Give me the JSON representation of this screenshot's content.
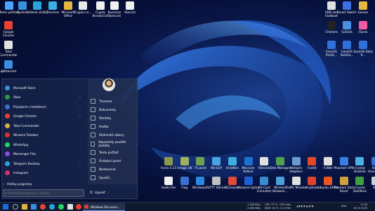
{
  "desktop_left": [
    {
      "label": "Tento počítač",
      "icon": "monitor-icon",
      "color": "#4aa3ff"
    },
    {
      "label": "System",
      "icon": "system-folder-icon",
      "color": "#3b8fe0"
    },
    {
      "label": "Sdílené složky",
      "icon": "shared-folders-icon",
      "color": "#2aa4d8"
    },
    {
      "label": "Thermoz",
      "icon": "thermoz-icon",
      "color": "#3bb0e0"
    },
    {
      "label": "Microsoft Office",
      "icon": "office-folder-icon",
      "color": "#e5b740"
    },
    {
      "label": "Crypto-co...",
      "icon": "crypto-file-icon",
      "color": "#e8e8e8"
    },
    {
      "label": "Crypto Revolut.txt",
      "icon": "text-file-icon",
      "color": "#f0f0f0"
    },
    {
      "label": "Business Tasks.txt",
      "icon": "text-file-icon",
      "color": "#f0f0f0"
    },
    {
      "label": "Stav.txt",
      "icon": "text-file-icon",
      "color": "#f0f0f0"
    }
  ],
  "desktop_left_col": [
    {
      "label": "Google Chrome",
      "icon": "chrome-icon",
      "color": "#e94235"
    },
    {
      "label": "Total Commander",
      "icon": "total-commander-icon",
      "color": "#e0e0e0"
    },
    {
      "label": "qBittorrent",
      "icon": "qbittorrent-icon",
      "color": "#3c8ee0"
    }
  ],
  "desktop_right": [
    {
      "label": "ADB and Fastboot",
      "icon": "adb-icon",
      "color": "#e0e0e0"
    },
    {
      "label": "Smart Switch",
      "icon": "smart-switch-icon",
      "color": "#3d6fe0"
    },
    {
      "label": "Games",
      "icon": "games-folder-icon",
      "color": "#e5b740"
    },
    {
      "label": "Chimera",
      "icon": "chimera-icon",
      "color": "#222222"
    },
    {
      "label": "5uTools",
      "icon": "5utools-icon",
      "color": "#4a90e2"
    },
    {
      "label": "iTunes",
      "icon": "itunes-icon",
      "color": "#f25ca2"
    },
    {
      "label": "EaseUS Partiti...",
      "icon": "easeus-partition-icon",
      "color": "#3070d8"
    },
    {
      "label": "EaseUS Partitio...",
      "icon": "easeus-partition-icon",
      "color": "#3070d8"
    },
    {
      "label": "EaseUS Data R...",
      "icon": "easeus-data-icon",
      "color": "#3070d8"
    }
  ],
  "desktop_bottom_row1": [
    {
      "label": "Force 4.11",
      "icon": "force-icon",
      "color": "#8a9a50"
    },
    {
      "label": "vmagic 88",
      "icon": "vmagic-icon",
      "color": "#a0b060"
    },
    {
      "label": "TS point",
      "icon": "ts-point-icon",
      "color": "#70a050"
    },
    {
      "label": "WinSCP",
      "icon": "winscp-icon",
      "color": "#4aa3e0"
    },
    {
      "label": "OneWire",
      "icon": "onewire-icon",
      "color": "#3cb0e0"
    },
    {
      "label": "Macrium Reflect",
      "icon": "macrium-icon",
      "color": "#1e6fd0"
    },
    {
      "label": "Telecam",
      "icon": "telecam-icon",
      "color": "#e0e0e0"
    },
    {
      "label": "Disk Manager",
      "icon": "disk-manager-icon",
      "color": "#50a050"
    },
    {
      "label": "Network Adapters",
      "icon": "network-icon",
      "color": "#6a9ad0"
    },
    {
      "label": "Foxit8",
      "icon": "foxit-icon",
      "color": "#e04a2a"
    },
    {
      "label": "FxNet",
      "icon": "fxnet-icon",
      "color": "#e0e0e0"
    },
    {
      "label": "Phantom VPN",
      "icon": "phantom-vpn-icon",
      "color": "#3a7ee0"
    },
    {
      "label": "Crystal Disklnfo",
      "icon": "crystal-diskinfo-icon",
      "color": "#4cb0e0"
    },
    {
      "label": "Revo Uninstaller",
      "icon": "revo-icon",
      "color": "#3a70d0"
    }
  ],
  "desktop_bottom_row2": [
    {
      "label": "Audio File",
      "icon": "audio-file-icon",
      "color": "#f0f0f0"
    },
    {
      "label": "Flag",
      "icon": "flag-icon",
      "color": "#3a70d0"
    },
    {
      "label": "Windows...",
      "icon": "windows-icon",
      "color": "#2a8ae0"
    },
    {
      "label": "PUTTY (64-bit)",
      "icon": "putty-icon",
      "color": "#c0c0c0"
    },
    {
      "label": "CCleaner",
      "icon": "ccleaner-icon",
      "color": "#e04a3a"
    },
    {
      "label": "Malware bytes",
      "icon": "malwarebytes-icon",
      "color": "#1e5fd0"
    },
    {
      "label": "SD Card Formatter",
      "icon": "sd-card-icon",
      "color": "#3a8ad0"
    },
    {
      "label": "Wireless Network...",
      "icon": "wireless-icon",
      "color": "#4aa0d8"
    },
    {
      "label": "Traffic Monitor",
      "icon": "traffic-monitor-icon",
      "color": "#e0e0e0"
    },
    {
      "label": "AnyDesk",
      "icon": "anydesk-icon",
      "color": "#e04030"
    },
    {
      "label": "Ubuntu 24.04",
      "icon": "ubuntu-icon",
      "color": "#e95420"
    },
    {
      "label": "Phantom Data Reset",
      "icon": "phantom-data-icon",
      "color": "#d0a040"
    },
    {
      "label": "Crystal DiskMark",
      "icon": "crystal-diskmark-icon",
      "color": "#40a040"
    },
    {
      "label": "Kôš",
      "icon": "recycle-bin-icon",
      "color": "#c8d0d8"
    }
  ],
  "start_menu": {
    "apps": [
      {
        "label": "Microsoft Store",
        "icon": "ms-store-icon",
        "color": "#3a8ee0",
        "chevron": ""
      },
      {
        "label": "Xbox",
        "icon": "xbox-icon",
        "color": "#2a9a3a",
        "chevron": "›"
      },
      {
        "label": "Pripojenie s telefónom",
        "icon": "phone-link-icon",
        "color": "#3a70d0",
        "chevron": "›"
      },
      {
        "label": "Google Chrome",
        "icon": "chrome-icon",
        "color": "#e94235",
        "chevron": "›"
      },
      {
        "label": "Total Commander",
        "icon": "total-commander-icon",
        "color": "#e0b040",
        "chevron": ""
      },
      {
        "label": "Winaero Tweaker",
        "icon": "winaero-icon",
        "color": "#e03030",
        "chevron": ""
      },
      {
        "label": "WhatsApp",
        "icon": "whatsapp-icon",
        "color": "#25d366",
        "chevron": "›"
      },
      {
        "label": "Messenger Plus",
        "icon": "messenger-icon",
        "color": "#8a4ae0",
        "chevron": ""
      },
      {
        "label": "Telegram Desktop",
        "icon": "telegram-icon",
        "color": "#2aa3e0",
        "chevron": "›"
      },
      {
        "label": "Instagram",
        "icon": "instagram-icon",
        "color": "#d6336c",
        "chevron": ""
      }
    ],
    "right": [
      {
        "label": "Thermoz",
        "icon": "folder-icon"
      },
      {
        "label": "Dokumenty",
        "icon": "documents-icon"
      },
      {
        "label": "Obrázky",
        "icon": "pictures-icon"
      },
      {
        "label": "Hudba",
        "icon": "music-icon"
      },
      {
        "label": "Stiahnuté súbory",
        "icon": "downloads-icon"
      },
      {
        "label": "Naposledy použité položky",
        "icon": "recent-icon",
        "chevron": "›"
      },
      {
        "label": "Tento počítač",
        "icon": "computer-icon"
      },
      {
        "label": "Ovládací panel",
        "icon": "control-panel-icon"
      },
      {
        "label": "Nastavenia",
        "icon": "settings-icon"
      },
      {
        "label": "Spustiť...",
        "icon": "run-icon"
      }
    ],
    "all_programs": "Všetky programy",
    "search_placeholder": "Prehľadať programy a súbory",
    "shutdown": "Vypnúť"
  },
  "taskbar": {
    "window_label": "Windows Discussio...",
    "net_up": "1.508 KB/s",
    "net_down": "2.660 KB/s",
    "cpu": "CPU: 57 %",
    "mem": "MEM: 45 %",
    "cpu_freq": "CPU freq:",
    "cpu_freq_val": "3.12 GHz",
    "lang": "ENG",
    "time": "17:09",
    "date": "16.10.2025"
  }
}
